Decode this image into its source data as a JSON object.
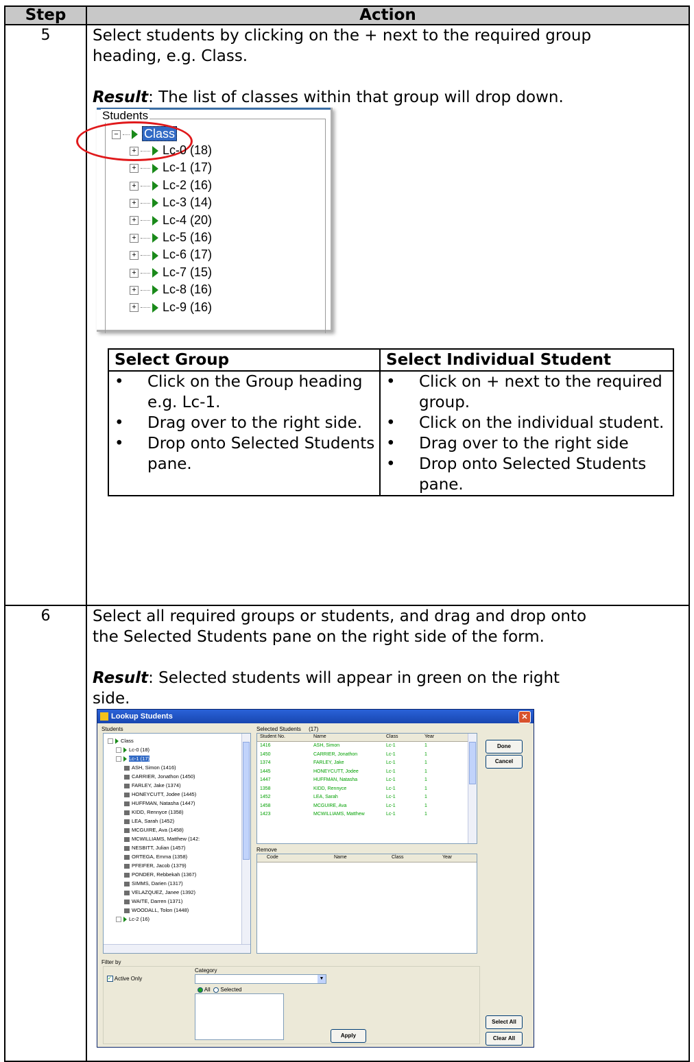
{
  "table": {
    "header_step": "Step",
    "header_action": "Action",
    "step5": {
      "number": "5",
      "line1": "Select students by clicking on the + next to the required group",
      "line2": "heading, e.g. Class.",
      "result_label": "Result",
      "result_text": ":  The list of classes within that group will drop down."
    },
    "tree_shot": {
      "legend": "Students",
      "root": "Class",
      "items": [
        "Lc-0 (18)",
        "Lc-1 (17)",
        "Lc-2 (16)",
        "Lc-3 (14)",
        "Lc-4 (20)",
        "Lc-5 (16)",
        "Lc-6 (17)",
        "Lc-7 (15)",
        "Lc-8 (16)",
        "Lc-9 (16)"
      ]
    },
    "inner": {
      "col1_header": "Select Group",
      "col2_header": "Select Individual Student",
      "col1": [
        "Click on the Group heading e.g. Lc-1.",
        "Drag over to the right side.",
        "Drop onto Selected Students pane."
      ],
      "col2": [
        "Click on + next to the required group.",
        "Click on the individual student.",
        "Drag over to the right side",
        "Drop onto Selected Students pane."
      ]
    },
    "step6": {
      "number": "6",
      "line1": "Select all required groups or students, and drag and drop onto",
      "line2": "the Selected Students pane on the right side of the form.",
      "result_label": "Result",
      "result_text_a": ":   Selected students will appear in green on the right",
      "result_text_b": "side."
    }
  },
  "lookup": {
    "title": "Lookup Students",
    "students_label": "Students",
    "selected_label": "Selected Students",
    "selected_count": "(17)",
    "remove_label": "Remove",
    "filter_label": "Filter by",
    "active_only": "Active Only",
    "category_label": "Category",
    "radio_all": "All",
    "radio_selected": "Selected",
    "buttons": {
      "done": "Done",
      "cancel": "Cancel",
      "apply": "Apply",
      "select_all": "Select All",
      "clear_all": "Clear All"
    },
    "sel_cols": [
      "Student No.",
      "Name",
      "Class",
      "Year"
    ],
    "rem_cols": [
      "Code",
      "Name",
      "Class",
      "Year"
    ],
    "sel_rows": [
      [
        "1416",
        "ASH, Simon",
        "Lc-1",
        "1"
      ],
      [
        "1450",
        "CARRIER, Jonathon",
        "Lc-1",
        "1"
      ],
      [
        "1374",
        "FARLEY, Jake",
        "Lc-1",
        "1"
      ],
      [
        "1445",
        "HONEYCUTT, Jodee",
        "Lc-1",
        "1"
      ],
      [
        "1447",
        "HUFFMAN, Natasha",
        "Lc-1",
        "1"
      ],
      [
        "1358",
        "KIDD, Rennyce",
        "Lc-1",
        "1"
      ],
      [
        "1452",
        "LEA, Sarah",
        "Lc-1",
        "1"
      ],
      [
        "1458",
        "MCGUIRE, Ava",
        "Lc-1",
        "1"
      ],
      [
        "1423",
        "MCWILLIAMS, Matthew",
        "Lc-1",
        "1"
      ]
    ],
    "tree_root": "Class",
    "tree_groups": [
      "Lc-0 (18)",
      "Lc-1 (17)"
    ],
    "tree_students": [
      "ASH, Simon (1416)",
      "CARRIER, Jonathon (1450)",
      "FARLEY, Jake (1374)",
      "HONEYCUTT, Jodee (1445)",
      "HUFFMAN, Natasha (1447)",
      "KIDD, Rennyce (1358)",
      "LEA, Sarah (1452)",
      "MCGUIRE, Ava (1458)",
      "MCWILLIAMS, Matthew (142:",
      "NESBITT, Julian (1457)",
      "ORTEGA, Emma (1358)",
      "PFEIFER, Jacob (1379)",
      "PONDER, Rebbekah (1367)",
      "SIMMS, Darien (1317)",
      "VELAZQUEZ, Janee (1392)",
      "WAITE, Darren (1371)",
      "WOODALL, Tolon (1448)"
    ],
    "tree_after": "Lc-2 (16)"
  }
}
